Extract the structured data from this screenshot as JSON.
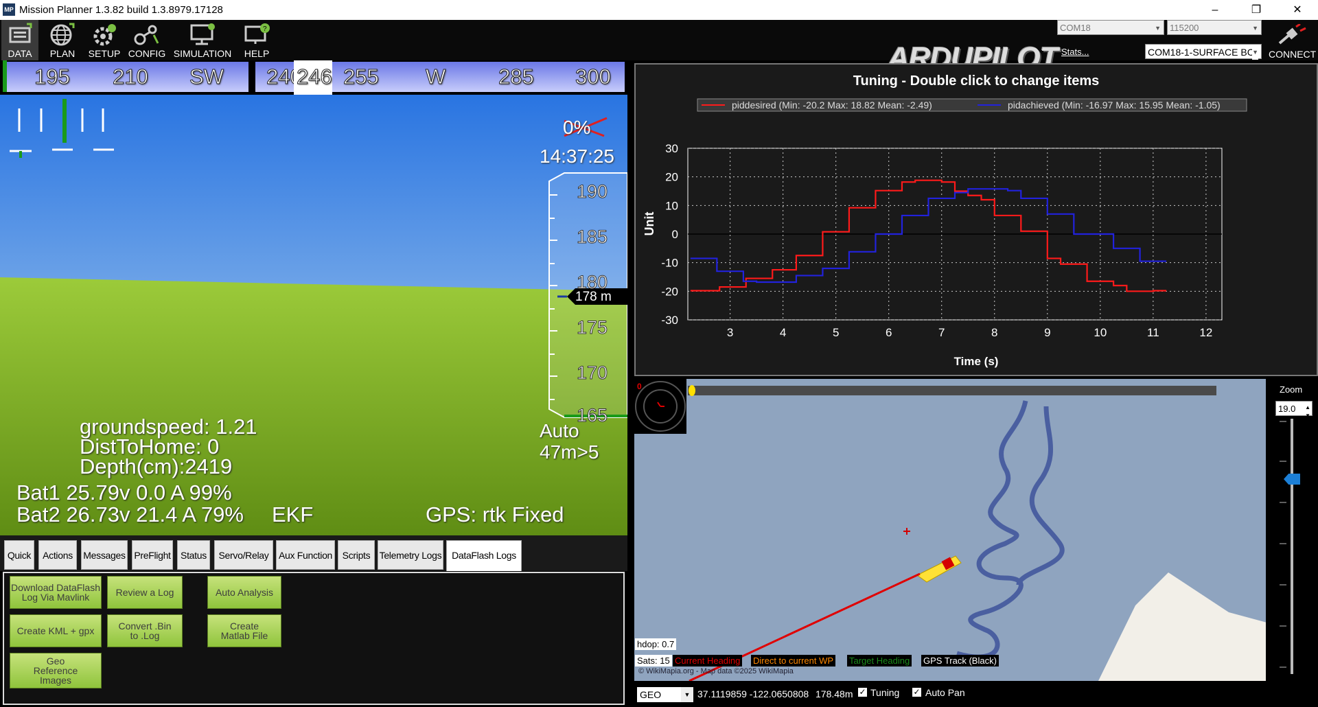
{
  "window": {
    "title": "Mission Planner 1.3.82 build 1.3.8979.17128",
    "app_icon": "MP",
    "minimize": "–",
    "maximize": "❐",
    "close": "✕"
  },
  "menu": {
    "items": [
      {
        "label": "DATA",
        "icon": "data-icon"
      },
      {
        "label": "PLAN",
        "icon": "globe-icon"
      },
      {
        "label": "SETUP",
        "icon": "setup-icon"
      },
      {
        "label": "CONFIG",
        "icon": "config-icon"
      },
      {
        "label": "SIMULATION",
        "icon": "simulation-icon"
      },
      {
        "label": "HELP",
        "icon": "help-icon"
      }
    ],
    "logo": "ARDUPILOT",
    "port": "COM18",
    "baud": "115200",
    "stats": "Stats...",
    "link": "COM18-1-SURFACE BC",
    "connect": "CONNECT"
  },
  "hud": {
    "heading_ticks": [
      "195",
      "210",
      "SW",
      "240",
      "255",
      "W",
      "285",
      "300"
    ],
    "heading_current": "246",
    "battery_pct_struck": "0%",
    "time": "14:37:25",
    "altitude_ticks": [
      "190",
      "185",
      "180",
      "175",
      "170",
      "165"
    ],
    "altitude_current": "178 m",
    "groundspeed": "groundspeed: 1.21",
    "dist_to_home": "DistToHome: 0",
    "depth": "Depth(cm):2419",
    "mode": "Auto",
    "wp": "47m>5",
    "bat1": "Bat1 25.79v 0.0 A 99%",
    "bat2": "Bat2 26.73v 21.4 A 79%",
    "ekf": "EKF",
    "gps": "GPS: rtk Fixed"
  },
  "tabs": [
    "Quick",
    "Actions",
    "Messages",
    "PreFlight",
    "Status",
    "Servo/Relay",
    "Aux Function",
    "Scripts",
    "Telemetry Logs",
    "DataFlash Logs"
  ],
  "active_tab": "DataFlash Logs",
  "dataflash_buttons": {
    "download": "Download DataFlash Log Via Mavlink",
    "review": "Review a Log",
    "auto_analysis": "Auto Analysis",
    "create_kml": "Create KML + gpx",
    "convert_bin": "Convert .Bin to .Log",
    "create_matlab": "Create Matlab File",
    "geo_reference": "Geo Reference Images"
  },
  "chart_data": {
    "type": "line",
    "title": "Tuning - Double click to change items",
    "xlabel": "Time (s)",
    "ylabel": "Unit",
    "xlim": [
      2.2,
      12.3
    ],
    "ylim": [
      -30,
      30
    ],
    "xticks": [
      3,
      4,
      5,
      6,
      7,
      8,
      9,
      10,
      11,
      12
    ],
    "yticks": [
      30,
      20,
      10,
      0,
      -10,
      -20,
      -30
    ],
    "grid": true,
    "legend_position": "top",
    "series": [
      {
        "name": "piddesired (Min: -20.2 Max: 18.82 Mean: -2.49)",
        "color": "#ff1a1a",
        "x": [
          2.25,
          2.5,
          2.8,
          3.1,
          3.3,
          3.6,
          3.8,
          4.0,
          4.25,
          4.5,
          4.75,
          5.0,
          5.25,
          5.5,
          5.75,
          6.0,
          6.25,
          6.5,
          6.75,
          7.0,
          7.25,
          7.5,
          7.75,
          8.0,
          8.25,
          8.5,
          8.75,
          9.0,
          9.25,
          9.5,
          9.75,
          10.0,
          10.25,
          10.5,
          10.75,
          11.0,
          11.25
        ],
        "y": [
          -19.8,
          -19.8,
          -18.5,
          -18.5,
          -15.5,
          -15.5,
          -12.5,
          -12.5,
          -7.5,
          -7.5,
          0.8,
          0.8,
          9.2,
          9.2,
          15.2,
          15.2,
          18.2,
          18.8,
          18.8,
          18.2,
          15.0,
          13.5,
          12.0,
          6.5,
          6.5,
          1.0,
          1.0,
          -8.5,
          -10.5,
          -10.5,
          -16.5,
          -16.5,
          -18.0,
          -20.0,
          -20.0,
          -19.8,
          -19.8
        ]
      },
      {
        "name": "pidachieved (Min: -16.97 Max: 15.95 Mean: -1.05)",
        "color": "#2222dd",
        "x": [
          2.25,
          2.5,
          2.75,
          3.0,
          3.25,
          3.5,
          3.75,
          4.0,
          4.25,
          4.5,
          4.75,
          5.0,
          5.25,
          5.5,
          5.75,
          6.0,
          6.25,
          6.5,
          6.75,
          7.0,
          7.25,
          7.5,
          7.75,
          8.0,
          8.25,
          8.5,
          8.75,
          9.0,
          9.25,
          9.5,
          9.75,
          10.0,
          10.25,
          10.5,
          10.75,
          11.0,
          11.25
        ],
        "y": [
          -8.5,
          -8.5,
          -13.0,
          -13.0,
          -16.5,
          -16.8,
          -16.8,
          -16.8,
          -14.5,
          -14.5,
          -12.0,
          -12.0,
          -6.2,
          -6.2,
          0.0,
          0.0,
          6.5,
          6.5,
          12.5,
          12.5,
          14.5,
          15.8,
          15.8,
          15.8,
          15.2,
          12.5,
          12.5,
          7.0,
          7.0,
          0.0,
          0.0,
          0.0,
          -5.0,
          -5.0,
          -9.5,
          -9.5,
          -9.5
        ]
      }
    ]
  },
  "map": {
    "zoom_label": "Zoom",
    "zoom_value": "19.0",
    "compass_value": "0",
    "hdop": "hdop: 0.7",
    "sats": "Sats: 15",
    "legend": {
      "current_heading": "Current Heading",
      "direct_to_wp": "Direct to current WP",
      "target_heading": "Target Heading",
      "gps_track": "GPS Track (Black)"
    },
    "attribution": "© WikiMapia.org - Map data ©2025 WikiMapia",
    "colors": {
      "water": "#8fa4bf",
      "land": "#f2efe8",
      "track": "#4a5fa0"
    }
  },
  "footer": {
    "coord_system": "GEO",
    "coords": "37.1119859 -122.0650808",
    "alt": "178.48m",
    "tuning": "Tuning",
    "auto_pan": "Auto Pan"
  }
}
